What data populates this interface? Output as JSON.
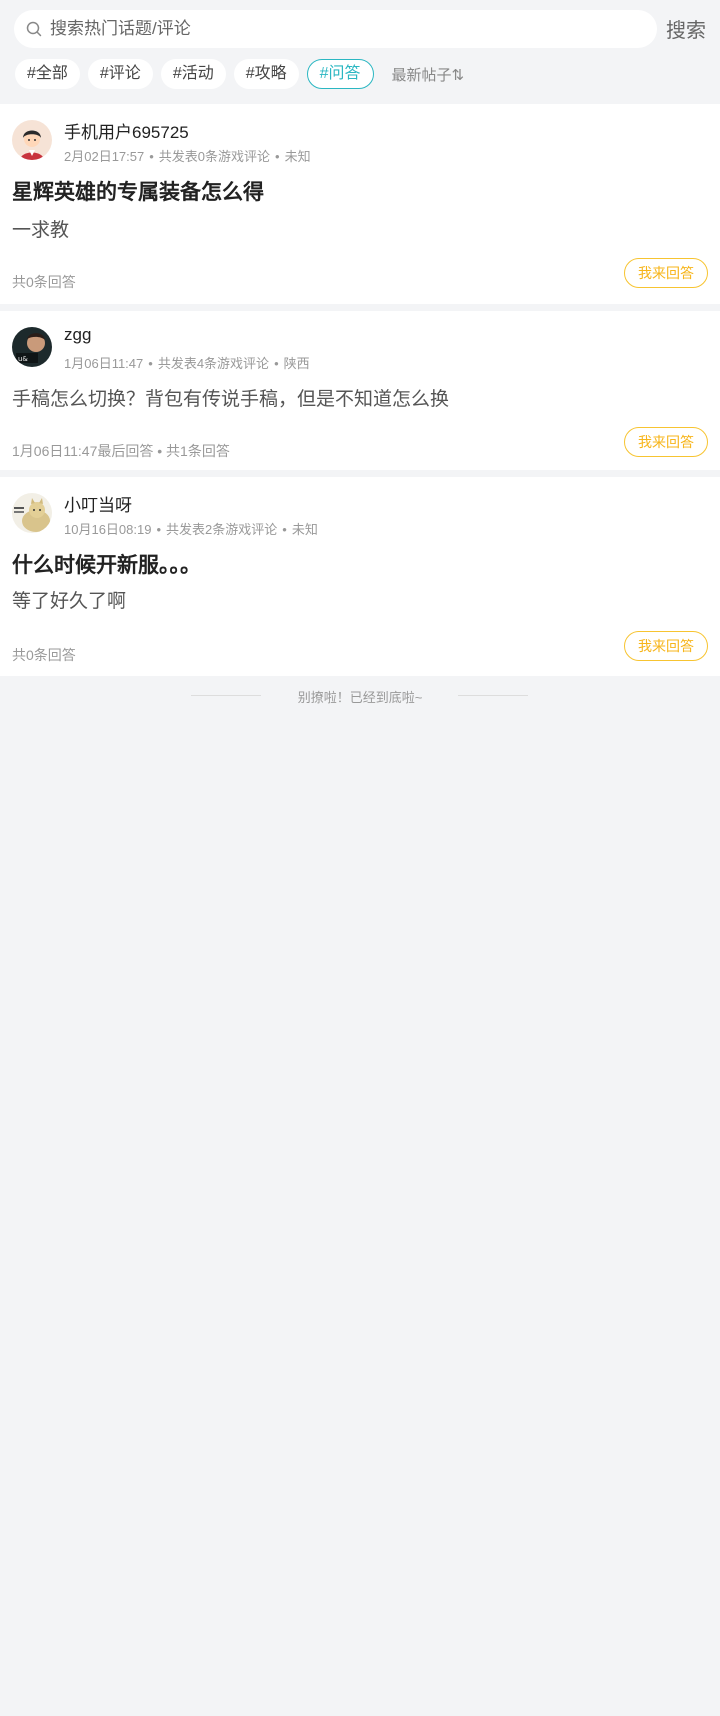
{
  "search": {
    "placeholder": "搜索热门话题/评论",
    "button_label": "搜索"
  },
  "tags": [
    {
      "label": "#全部",
      "active": false
    },
    {
      "label": "#评论",
      "active": false
    },
    {
      "label": "#活动",
      "active": false
    },
    {
      "label": "#攻略",
      "active": false
    },
    {
      "label": "#问答",
      "active": true
    }
  ],
  "sort": {
    "label": "最新帖子⇅"
  },
  "colors": {
    "accent_teal": "#2bb7c2",
    "answer_yellow": "#f7c431",
    "background": "#f3f4f6"
  },
  "posts": [
    {
      "author": "手机用户695725",
      "avatar_icon": "cartoon-avatar-icon",
      "time": "2月02日17:57",
      "post_count": "共发表0条游戏评论",
      "location": "未知",
      "title": "星辉英雄的专属装备怎么得",
      "body": "一求教",
      "footer": "共0条回答",
      "answer_label": "我来回答"
    },
    {
      "author": "zgg",
      "avatar_icon": "photo-avatar-icon",
      "time": "1月06日11:47",
      "post_count": "共发表4条游戏评论",
      "location": "陕西",
      "title": "",
      "body": "手稿怎么切换？背包有传说手稿，但是不知道怎么换",
      "footer": "1月06日11:47最后回答 • 共1条回答",
      "answer_label": "我来回答"
    },
    {
      "author": "小叮当呀",
      "avatar_icon": "cat-avatar-icon",
      "time": "10月16日08:19",
      "post_count": "共发表2条游戏评论",
      "location": "未知",
      "title": "什么时候开新服。。。",
      "body": "等了好久了啊",
      "footer": "共0条回答",
      "answer_label": "我来回答"
    }
  ],
  "end_note": "别撩啦！已经到底啦~"
}
